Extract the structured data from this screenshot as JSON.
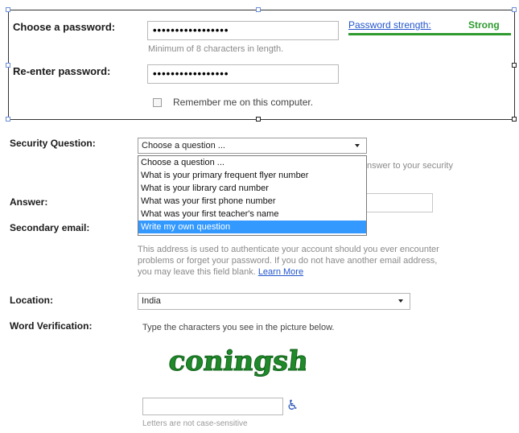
{
  "password": {
    "label": "Choose a password:",
    "value_mask": "•••••••••••••••••",
    "hint": "Minimum of 8 characters in length.",
    "strength_label": "Password strength:",
    "strength_value": "Strong",
    "strength_color": "#2e9b2e"
  },
  "reenter": {
    "label": "Re-enter password:",
    "value_mask": "•••••••••••••••••"
  },
  "remember": {
    "label": "Remember me on this computer."
  },
  "security": {
    "label": "Security Question:",
    "selected": "Choose a question ...",
    "options": [
      "Choose a question ...",
      "What is your primary frequent flyer number",
      "What is your library card number",
      "What was your first phone number",
      "What was your first teacher's name",
      "Write my own question"
    ],
    "highlighted_option": "Write my own question",
    "hidden_hint_fragment": "nswer to your security"
  },
  "answer": {
    "label": "Answer:"
  },
  "secondary_email": {
    "label": "Secondary email:",
    "help_line1": "This address is used to authenticate your account should you ever encounter",
    "help_line2": "problems or forget your password. If you do not have another email address,",
    "help_line3": "you may leave this field blank.",
    "learn_more": "Learn More"
  },
  "location": {
    "label": "Location:",
    "value": "India"
  },
  "word_verification": {
    "label": "Word Verification:",
    "instruction": "Type the characters you see in the picture below.",
    "captcha_text": "coningsh",
    "case_note": "Letters are not case-sensitive",
    "accessibility_icon": "wheelchair-icon"
  },
  "colors": {
    "link": "#2255cc",
    "dropdown_highlight": "#3399ff",
    "strength_bar": "#2e9b2e"
  }
}
